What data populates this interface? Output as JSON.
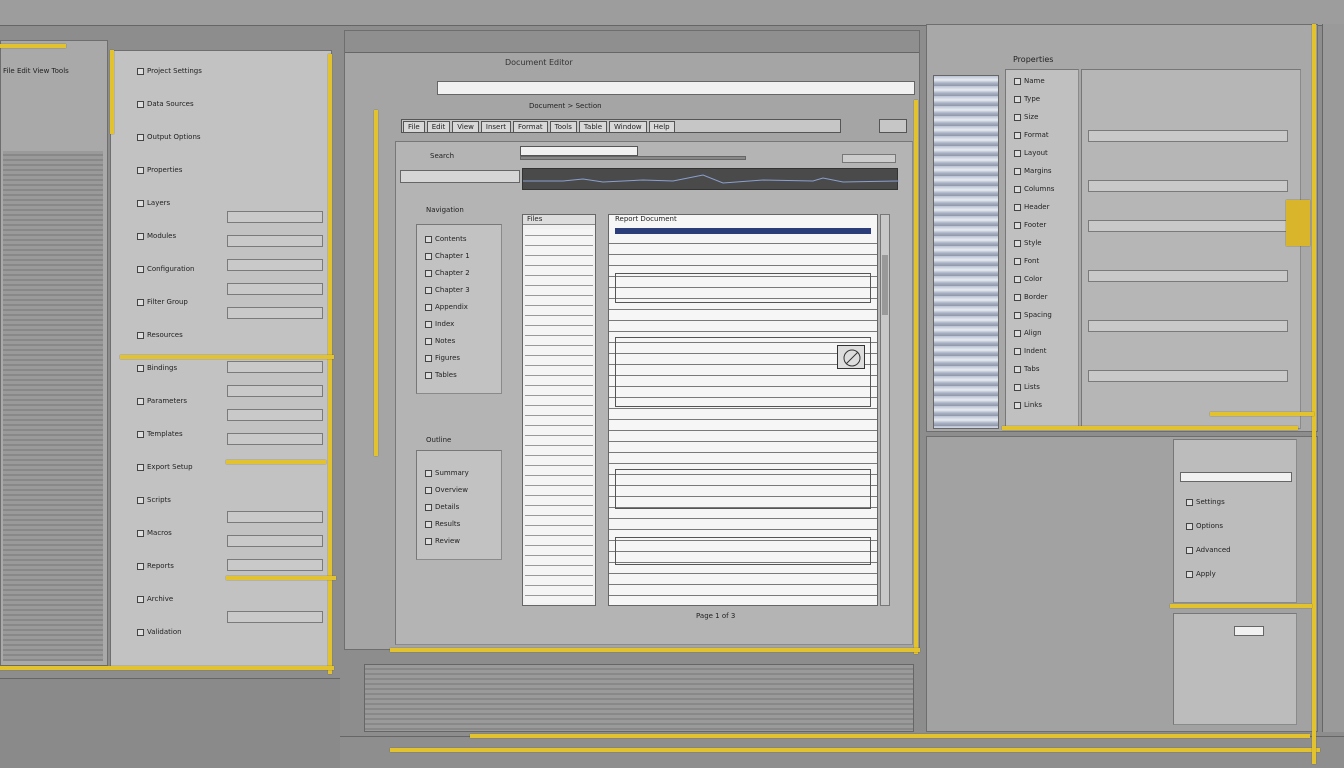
{
  "colors": {
    "accent": "#e3c230",
    "selection": "#2c3e7a",
    "background": "#8d8d8d"
  },
  "left_panel": {
    "header": "File Edit View Tools",
    "items": [
      "Project Settings",
      "Data Sources",
      "Output Options",
      "Properties",
      "Layers",
      "Modules",
      "Configuration",
      "Filter Group",
      "Resources",
      "Bindings",
      "Parameters",
      "Templates",
      "Export Setup",
      "Scripts",
      "Macros",
      "Reports",
      "Archive",
      "Validation"
    ]
  },
  "center_window": {
    "title": "Document Editor",
    "toolbar": [
      "File",
      "Edit",
      "View",
      "Insert",
      "Format",
      "Tools",
      "Table",
      "Window",
      "Help"
    ],
    "search_label": "Search",
    "search_placeholder": "",
    "breadcrumb": "Document > Section",
    "nav_title": "Navigation",
    "nav_items": [
      "Contents",
      "Chapter 1",
      "Chapter 2",
      "Chapter 3",
      "Appendix",
      "Index",
      "Notes",
      "Figures",
      "Tables"
    ],
    "nav2_title": "Outline",
    "nav2_items": [
      "Summary",
      "Overview",
      "Details",
      "Results",
      "Review"
    ],
    "list_title": "Files",
    "doc_title": "Report Document",
    "status": "Page 1 of 3"
  },
  "right_panel": {
    "header": "Properties",
    "items": [
      "Name",
      "Type",
      "Size",
      "Format",
      "Layout",
      "Margins",
      "Columns",
      "Header",
      "Footer",
      "Style",
      "Font",
      "Color",
      "Border",
      "Spacing",
      "Align",
      "Indent",
      "Tabs",
      "Lists",
      "Links"
    ],
    "lower_items": [
      "Settings",
      "Options",
      "Advanced",
      "Apply"
    ]
  }
}
